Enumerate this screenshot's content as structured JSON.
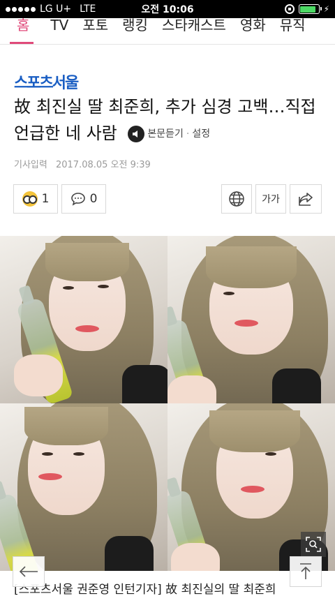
{
  "status_bar": {
    "carrier": "LG U+",
    "network": "LTE",
    "time": "오전 10:06"
  },
  "nav": {
    "items": [
      {
        "label": "홈",
        "active": true
      },
      {
        "label": "TV"
      },
      {
        "label": "포토"
      },
      {
        "label": "랭킹"
      },
      {
        "label": "스타캐스트"
      },
      {
        "label": "영화"
      },
      {
        "label": "뮤직"
      }
    ]
  },
  "article": {
    "press": "스포츠서울",
    "headline": "故 최진실 딸 최준희, 추가 심경 고백…직접 언급한 네 사람",
    "listen_label": "본문듣기",
    "settings_label": "설정",
    "meta_label": "기사입력",
    "meta_date": "2017.08.05 오전 9:39",
    "like_count": "1",
    "comment_count": "0",
    "font_button_label": "가가",
    "caption": "[스포츠서울 권준영 인턴기자] 故 최진실의 딸 최준희"
  },
  "colors": {
    "accent": "#e04a7a",
    "press_logo": "#1a5ec3"
  },
  "icons": [
    "speaker-icon",
    "emoji-icon",
    "comment-icon",
    "globe-icon",
    "share-icon",
    "zoom-icon",
    "back-arrow-icon",
    "scroll-top-icon"
  ]
}
